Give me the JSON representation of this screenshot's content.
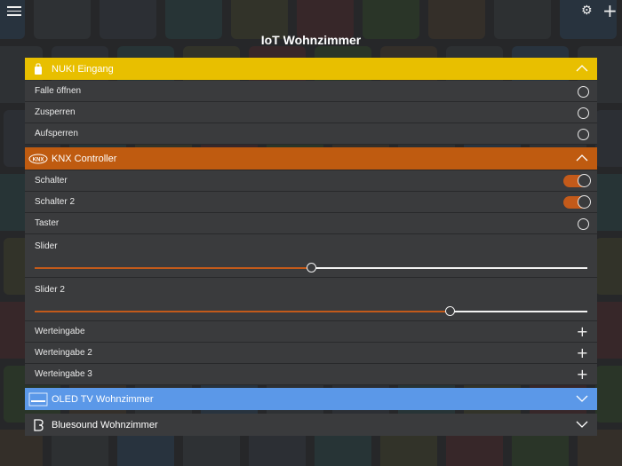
{
  "colors": {
    "nuki_header": "#e8bf00",
    "knx_header": "#bf5b10",
    "tv_header": "#5b98e8",
    "bluesound_header": "#3a3b3d",
    "accent": "#c35a1a"
  },
  "topbar": {
    "title": "IoT Wohnzimmer",
    "menu_icon": "hamburger-icon",
    "settings_icon": "gear-icon",
    "add_icon": "plus-icon",
    "settings_glyph": "⚙",
    "add_glyph": "+"
  },
  "groups": {
    "nuki": {
      "label": "NUKI Eingang",
      "expanded": true,
      "items": [
        {
          "label": "Falle öffnen",
          "control": "radio"
        },
        {
          "label": "Zusperren",
          "control": "radio"
        },
        {
          "label": "Aufsperren",
          "control": "radio"
        }
      ]
    },
    "knx": {
      "label": "KNX Controller",
      "icon_text": "KNX",
      "expanded": true,
      "switch1": {
        "label": "Schalter",
        "on": true
      },
      "switch2": {
        "label": "Schalter 2",
        "on": true
      },
      "button": {
        "label": "Taster"
      },
      "slider1": {
        "label": "Slider",
        "value": 0.5
      },
      "slider2": {
        "label": "Slider 2",
        "value": 0.75
      },
      "input1": {
        "label": "Werteingabe"
      },
      "input2": {
        "label": "Werteingabe 2"
      },
      "input3": {
        "label": "Werteingabe 3"
      }
    },
    "tv": {
      "label": "OLED TV Wohnzimmer",
      "expanded": false
    },
    "bluesound": {
      "label": "Bluesound Wohnzimmer",
      "expanded": false
    }
  }
}
